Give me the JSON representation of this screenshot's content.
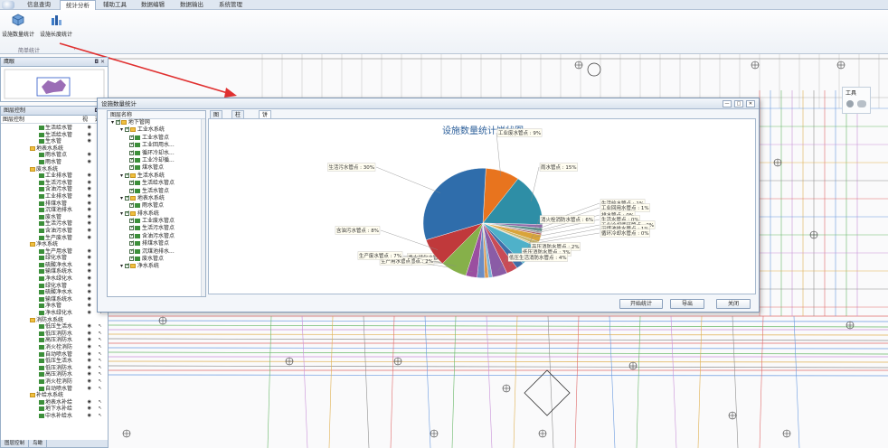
{
  "menu": {
    "tabs": [
      "信息查询",
      "统计分析",
      "辅助工具",
      "数据编辑",
      "数据输出",
      "系统管理"
    ],
    "active_index": 1
  },
  "ribbon": {
    "btn_count": "设施数量统计",
    "btn_length": "设施长度统计",
    "group_label": "简单统计"
  },
  "overview": {
    "title": "鹰眼"
  },
  "layer_panel": {
    "title": "图层控制",
    "header": "图层控制",
    "col_view": "视",
    "col_select": "选",
    "rows": [
      {
        "t": "l",
        "label": "生活给水管"
      },
      {
        "t": "l",
        "label": "生活给水管"
      },
      {
        "t": "l",
        "label": "生水管"
      },
      {
        "t": "f",
        "label": "地表水系统"
      },
      {
        "t": "l",
        "label": "雨水管点"
      },
      {
        "t": "l",
        "label": "雨水管"
      },
      {
        "t": "f",
        "label": "废水系统"
      },
      {
        "t": "l",
        "label": "工业排水管"
      },
      {
        "t": "l",
        "label": "生活污水管"
      },
      {
        "t": "l",
        "label": "含油污水管"
      },
      {
        "t": "l",
        "label": "工业排水管"
      },
      {
        "t": "l",
        "label": "排煤水管"
      },
      {
        "t": "l",
        "label": "沉煤池排水"
      },
      {
        "t": "l",
        "label": "废水管"
      },
      {
        "t": "l",
        "label": "生活污水管"
      },
      {
        "t": "l",
        "label": "含油污水管"
      },
      {
        "t": "l",
        "label": "生产废水管"
      },
      {
        "t": "f",
        "label": "净水系统"
      },
      {
        "t": "l",
        "label": "生产用水管"
      },
      {
        "t": "l",
        "label": "绿化水管"
      },
      {
        "t": "l",
        "label": "硫酸净水水"
      },
      {
        "t": "l",
        "label": "输煤系统水"
      },
      {
        "t": "l",
        "label": "净水绿化水"
      },
      {
        "t": "l",
        "label": "绿化水管"
      },
      {
        "t": "l",
        "label": "硫酸净水水"
      },
      {
        "t": "l",
        "label": "输煤系统水"
      },
      {
        "t": "l",
        "label": "净水管"
      },
      {
        "t": "l",
        "label": "净水绿化水"
      },
      {
        "t": "f",
        "label": "消防水系统"
      },
      {
        "t": "l",
        "label": "低压生活水"
      },
      {
        "t": "l",
        "label": "低压消防水"
      },
      {
        "t": "l",
        "label": "高压消防水"
      },
      {
        "t": "l",
        "label": "消火栓消防"
      },
      {
        "t": "l",
        "label": "自动喷水管"
      },
      {
        "t": "l",
        "label": "低压生活水"
      },
      {
        "t": "l",
        "label": "低压消防水"
      },
      {
        "t": "l",
        "label": "高压消防水"
      },
      {
        "t": "l",
        "label": "消火栓消防"
      },
      {
        "t": "l",
        "label": "自动喷水管"
      },
      {
        "t": "f",
        "label": "补给水系统"
      },
      {
        "t": "l",
        "label": "地表水补给"
      },
      {
        "t": "l",
        "label": "地下水补给"
      },
      {
        "t": "l",
        "label": "中水补给水"
      }
    ],
    "bottom_tabs": [
      "图层控制",
      "鸟瞰"
    ]
  },
  "tool_panel": {
    "title": "工具"
  },
  "dialog": {
    "title": "设施数量统计",
    "tree": {
      "header": "图层名称",
      "rows": [
        {
          "lv": 0,
          "f": true,
          "label": "地下管网"
        },
        {
          "lv": 1,
          "f": true,
          "label": "工业水系统"
        },
        {
          "lv": 2,
          "f": false,
          "label": "工业水管点"
        },
        {
          "lv": 2,
          "f": false,
          "label": "工业回用水..."
        },
        {
          "lv": 2,
          "f": false,
          "label": "循环冷却水..."
        },
        {
          "lv": 2,
          "f": false,
          "label": "工业冷却循..."
        },
        {
          "lv": 2,
          "f": false,
          "label": "煤水管点"
        },
        {
          "lv": 1,
          "f": true,
          "label": "生活水系统"
        },
        {
          "lv": 2,
          "f": false,
          "label": "生活给水管点"
        },
        {
          "lv": 2,
          "f": false,
          "label": "生活水管点"
        },
        {
          "lv": 1,
          "f": true,
          "label": "地表水系统"
        },
        {
          "lv": 2,
          "f": false,
          "label": "雨水管点"
        },
        {
          "lv": 1,
          "f": true,
          "label": "排水系统"
        },
        {
          "lv": 2,
          "f": false,
          "label": "工业废水管点"
        },
        {
          "lv": 2,
          "f": false,
          "label": "生活污水管点"
        },
        {
          "lv": 2,
          "f": false,
          "label": "含油污水管点"
        },
        {
          "lv": 2,
          "f": false,
          "label": "排煤水管点"
        },
        {
          "lv": 2,
          "f": false,
          "label": "沉煤池排水..."
        },
        {
          "lv": 2,
          "f": false,
          "label": "废水管点"
        },
        {
          "lv": 1,
          "f": true,
          "label": "净水系统"
        }
      ]
    },
    "tabs": [
      "图表",
      "柱状图",
      "饼状图"
    ],
    "active_tab": 2,
    "buttons": {
      "start": "开始统计",
      "export": "导出",
      "close": "关闭"
    }
  },
  "chart_data": {
    "type": "pie",
    "title": "设施数量统计饼状图",
    "slices": [
      {
        "label": "工业废水管点",
        "value": 9,
        "text": "工业废水管点 : 9%",
        "color": "#e8741e"
      },
      {
        "label": "雨水管点",
        "value": 15,
        "text": "雨水管点 : 15%",
        "color": "#2e8ea6"
      },
      {
        "label": "生活给水管点",
        "value": 1,
        "text": "生活给水管点 : 1%",
        "color": "#8e6aa8"
      },
      {
        "label": "工业回用水管点",
        "value": 1,
        "text": "工业回用水管点 : 1%",
        "color": "#5d8f8a"
      },
      {
        "label": "排水管点",
        "value": 0.5,
        "text": "排水管点 : 0%",
        "color": "#a0a0a8"
      },
      {
        "label": "生活水管点",
        "value": 0.5,
        "text": "生活水管点 : 0%",
        "color": "#b06060"
      },
      {
        "label": "工业冷却循环管点",
        "value": 2,
        "text": "工业冷却循环管点 : 2%",
        "color": "#d9a43a"
      },
      {
        "label": "沉煤池排水管点",
        "value": 1,
        "text": "沉煤池排水管点 : 1%",
        "color": "#c7b56a"
      },
      {
        "label": "循环冷却水管点",
        "value": 0.5,
        "text": "循环冷却水管点 : 0%",
        "color": "#d6c8a0"
      },
      {
        "label": "消火栓消防水管点",
        "value": 6,
        "text": "消火栓消防水管点 : 6%",
        "color": "#4fb1c9"
      },
      {
        "label": "高压消防水管点",
        "value": 2,
        "text": "高压消防水管点 : 2%",
        "color": "#3d6ea8"
      },
      {
        "label": "低压消防水管点",
        "value": 3,
        "text": "低压消防水管点 : 3%",
        "color": "#c84b56"
      },
      {
        "label": "低压生活消防水管点",
        "value": 4,
        "text": "低压生活消防水管点 : 4%",
        "color": "#8a5ca6"
      },
      {
        "label": "自动喷水管点",
        "value": 1,
        "text": "自动喷水管点 : 1%",
        "color": "#7bb3d6"
      },
      {
        "label": "净水绿化水管点",
        "value": 1,
        "text": "净水绿化水管点 : 1%",
        "color": "#e09a50"
      },
      {
        "label": "净水管点",
        "value": 2,
        "text": "净水管点 : 2%",
        "color": "#6a8cc4"
      },
      {
        "label": "生产用水管点",
        "value": 3,
        "text": "生产用水管点",
        "color": "#9a4fa0"
      },
      {
        "label": "生产废水管点",
        "value": 7,
        "text": "生产废水管点 : 7%",
        "color": "#86b04a"
      },
      {
        "label": "含油污水管点",
        "value": 8,
        "text": "含油污水管点 : 8%",
        "color": "#c0393b"
      },
      {
        "label": "生活污水管点",
        "value": 30,
        "text": "生活污水管点 : 30%",
        "color": "#2f6dab"
      }
    ]
  }
}
